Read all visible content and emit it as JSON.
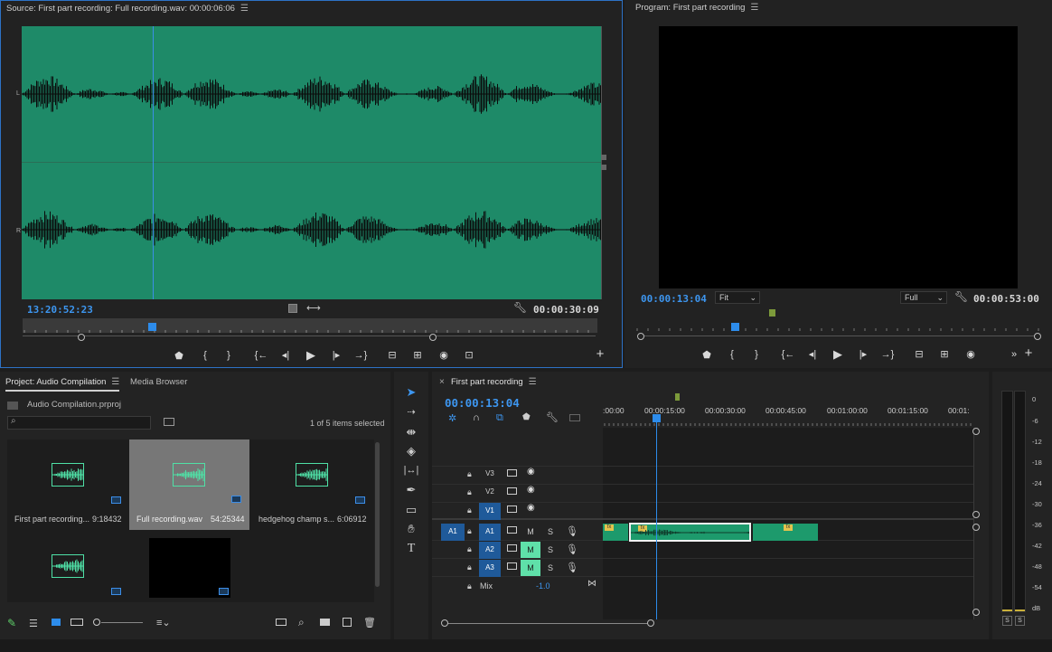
{
  "source": {
    "title": "Source: First part recording: Full recording.wav: 00:00:06:06",
    "channel_labels": [
      "L",
      "L",
      "R",
      "R"
    ],
    "playhead_time": "13:20:52:23",
    "duration": "00:00:30:09",
    "waveform_color": "#1e8a68"
  },
  "program": {
    "title": "Program: First part recording",
    "timecode": "00:00:13:04",
    "fit": "Fit",
    "resolution": "Full",
    "duration": "00:00:53:00"
  },
  "project": {
    "tab_project": "Project: Audio Compilation",
    "tab_media": "Media Browser",
    "filename": "Audio Compilation.prproj",
    "search_placeholder": "",
    "selection_info": "1 of 5 items selected",
    "items": [
      {
        "name": "First part recording...",
        "duration": "9:18432"
      },
      {
        "name": "Full recording.wav",
        "duration": "54:25344"
      },
      {
        "name": "hedgehog champ s...",
        "duration": "6:06912"
      },
      {
        "name": "",
        "duration": ""
      },
      {
        "name": "",
        "duration": ""
      }
    ]
  },
  "timeline": {
    "title": "First part recording",
    "timecode": "00:00:13:04",
    "ruler": [
      ":00:00",
      "00:00:15:00",
      "00:00:30:00",
      "00:00:45:00",
      "00:01:00:00",
      "00:01:15:00",
      "00:01:"
    ],
    "video_tracks": [
      {
        "name": "V3",
        "highlight": false
      },
      {
        "name": "V2",
        "highlight": false
      },
      {
        "name": "V1",
        "highlight": true
      }
    ],
    "audio_tracks": [
      {
        "source": "A1",
        "name": "A1",
        "m": "M",
        "s": "S",
        "mute_on": false
      },
      {
        "source": "",
        "name": "A2",
        "m": "M",
        "s": "S",
        "mute_on": true
      },
      {
        "source": "",
        "name": "A3",
        "m": "M",
        "s": "S",
        "mute_on": true
      }
    ],
    "mix_label": "Mix",
    "mix_value": "-1.0",
    "fx_label": "fx"
  },
  "meter": {
    "scale": [
      "0",
      "-6",
      "-12",
      "-18",
      "-24",
      "-30",
      "-36",
      "-42",
      "-48",
      "-54",
      "dB"
    ],
    "solo": [
      "S",
      "S"
    ]
  },
  "colors": {
    "accent": "#2d8ceb",
    "audio_clip": "#1d9a6c",
    "mute_on": "#5fe0a9"
  }
}
